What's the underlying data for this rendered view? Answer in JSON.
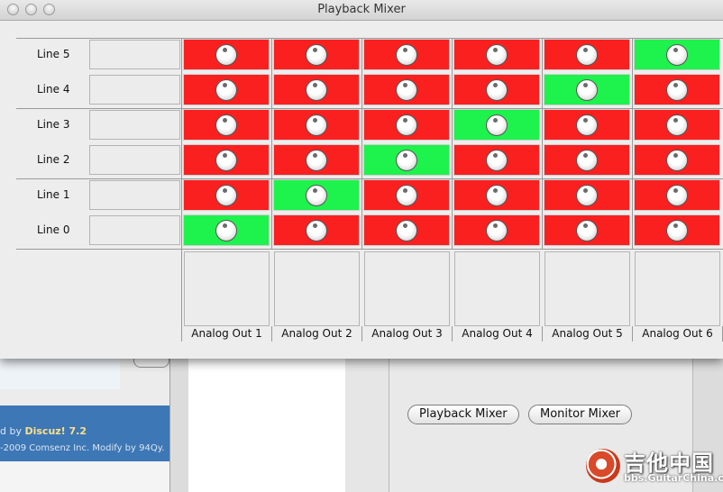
{
  "window": {
    "title": "Playback Mixer"
  },
  "mixer": {
    "rows": [
      {
        "label": "Line 5",
        "cells": [
          false,
          false,
          false,
          false,
          false,
          true
        ]
      },
      {
        "label": "Line 4",
        "cells": [
          false,
          false,
          false,
          false,
          true,
          false
        ]
      },
      {
        "label": "Line 3",
        "cells": [
          false,
          false,
          false,
          true,
          false,
          false
        ]
      },
      {
        "label": "Line 2",
        "cells": [
          false,
          false,
          true,
          false,
          false,
          false
        ]
      },
      {
        "label": "Line 1",
        "cells": [
          false,
          true,
          false,
          false,
          false,
          false
        ]
      },
      {
        "label": "Line 0",
        "cells": [
          true,
          false,
          false,
          false,
          false,
          false
        ]
      }
    ],
    "outputs": [
      "Analog Out 1",
      "Analog Out 2",
      "Analog Out 3",
      "Analog Out 4",
      "Analog Out 5",
      "Analog Out 6"
    ],
    "colors": {
      "on": "#1ef24c",
      "off": "#fa2020"
    }
  },
  "background_window": {
    "buttons": {
      "playback": "Playback Mixer",
      "monitor": "Monitor Mixer"
    }
  },
  "footer": {
    "line1_prefix": "d by",
    "brand": "Discuz! 7.2",
    "line2": "-2009 Comsenz Inc. Modify by 94Qy."
  },
  "watermark": {
    "title": "吉他中国",
    "subtitle": "bbs.GuitarChina.com"
  }
}
